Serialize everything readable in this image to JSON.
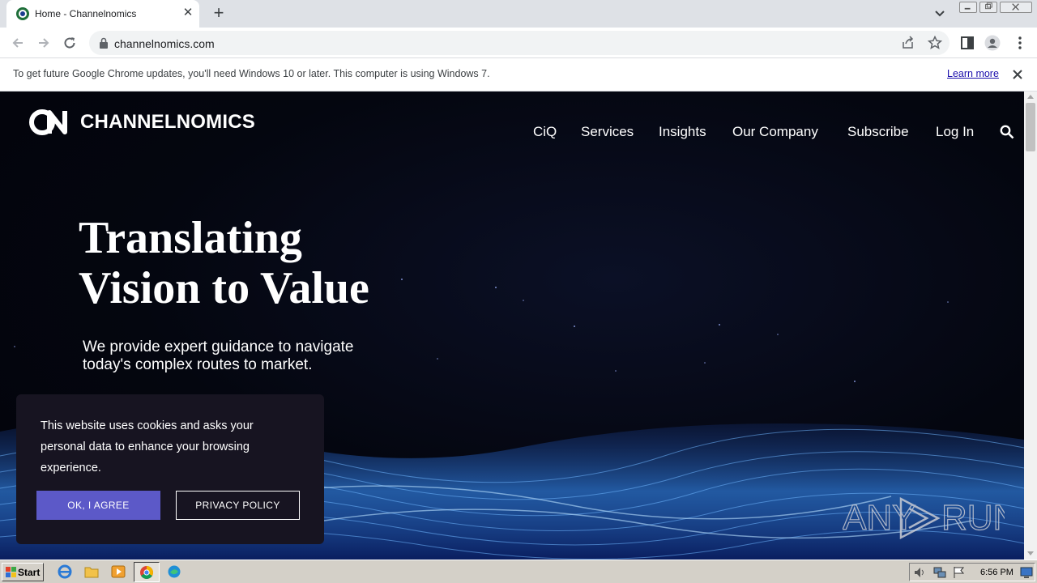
{
  "browser": {
    "tab_title": "Home - Channelnomics",
    "url": "channelnomics.com",
    "new_tab_label": "+",
    "tab_close_label": "✕"
  },
  "infobar": {
    "message": "To get future Google Chrome updates, you'll need Windows 10 or later. This computer is using Windows 7.",
    "link": "Learn more"
  },
  "site": {
    "brand": "CHANNELNOMICS",
    "nav": [
      "CiQ",
      "Services",
      "Insights",
      "Our Company",
      "Subscribe",
      "Log In"
    ],
    "hero_title_line1": "Translating",
    "hero_title_line2": "Vision to Value",
    "hero_sub_line1": "We provide expert guidance to navigate",
    "hero_sub_line2": "today's complex routes to market."
  },
  "cookie": {
    "message": "This website uses cookies and asks your personal data to enhance your browsing experience.",
    "ok_label": "OK, I AGREE",
    "privacy_label": "PRIVACY POLICY"
  },
  "watermark": {
    "left": "ANY",
    "right": "RUN"
  },
  "taskbar": {
    "start_label": "Start",
    "clock": "6:56 PM"
  },
  "colors": {
    "accent_button": "#5c59c8",
    "page_bg": "#04060f",
    "link": "#1a0dab"
  }
}
